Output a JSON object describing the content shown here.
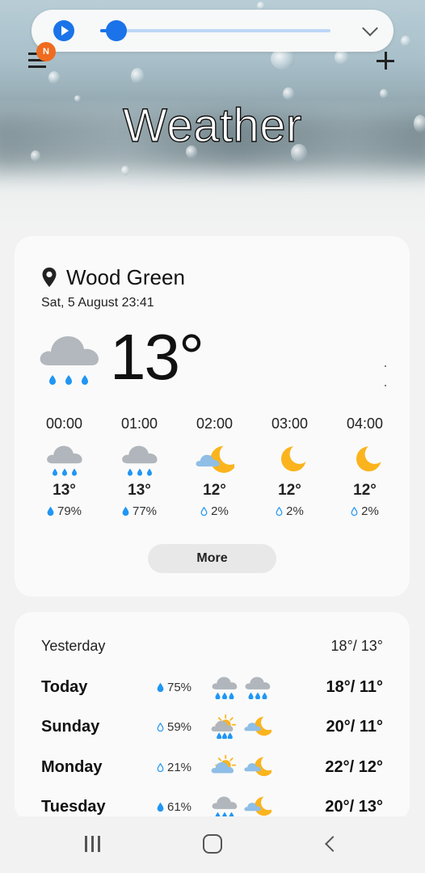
{
  "media_player": {
    "progress_fraction": 0.07
  },
  "header": {
    "title": "Weather",
    "notification_badge": "N"
  },
  "current": {
    "location": "Wood Green",
    "datetime": "Sat, 5 August 23:41",
    "temperature": "13°",
    "condition_icon": "rain-cloud-icon"
  },
  "hourly": [
    {
      "time": "00:00",
      "icon": "rain-cloud-icon",
      "temp": "13°",
      "precip": "79%",
      "drop": "filled"
    },
    {
      "time": "01:00",
      "icon": "rain-cloud-icon",
      "temp": "13°",
      "precip": "77%",
      "drop": "filled"
    },
    {
      "time": "02:00",
      "icon": "moon-cloud-icon",
      "temp": "12°",
      "precip": "2%",
      "drop": "outline"
    },
    {
      "time": "03:00",
      "icon": "moon-icon",
      "temp": "12°",
      "precip": "2%",
      "drop": "outline"
    },
    {
      "time": "04:00",
      "icon": "moon-icon",
      "temp": "12°",
      "precip": "2%",
      "drop": "outline"
    }
  ],
  "more_label": "More",
  "daily": [
    {
      "day": "Yesterday",
      "precip": "",
      "icons": [],
      "temps": "18°/ 13°"
    },
    {
      "day": "Today",
      "precip": "75%",
      "icons": [
        "rain-cloud-icon",
        "rain-cloud-icon"
      ],
      "temps": "18°/ 11°"
    },
    {
      "day": "Sunday",
      "precip": "59%",
      "icons": [
        "sun-rain-cloud-icon",
        "moon-cloud-icon"
      ],
      "temps": "20°/ 11°"
    },
    {
      "day": "Monday",
      "precip": "21%",
      "icons": [
        "sun-cloud-icon",
        "moon-cloud-icon"
      ],
      "temps": "22°/ 12°"
    },
    {
      "day": "Tuesday",
      "precip": "61%",
      "icons": [
        "rain-cloud-icon",
        "moon-cloud-icon"
      ],
      "temps": "20°/ 13°"
    }
  ],
  "colors": {
    "accent": "#1a73e8",
    "badge": "#ef6c1f",
    "rain": "#2196f3",
    "moon": "#fbb41d",
    "cloud": "#b0b6bb"
  }
}
